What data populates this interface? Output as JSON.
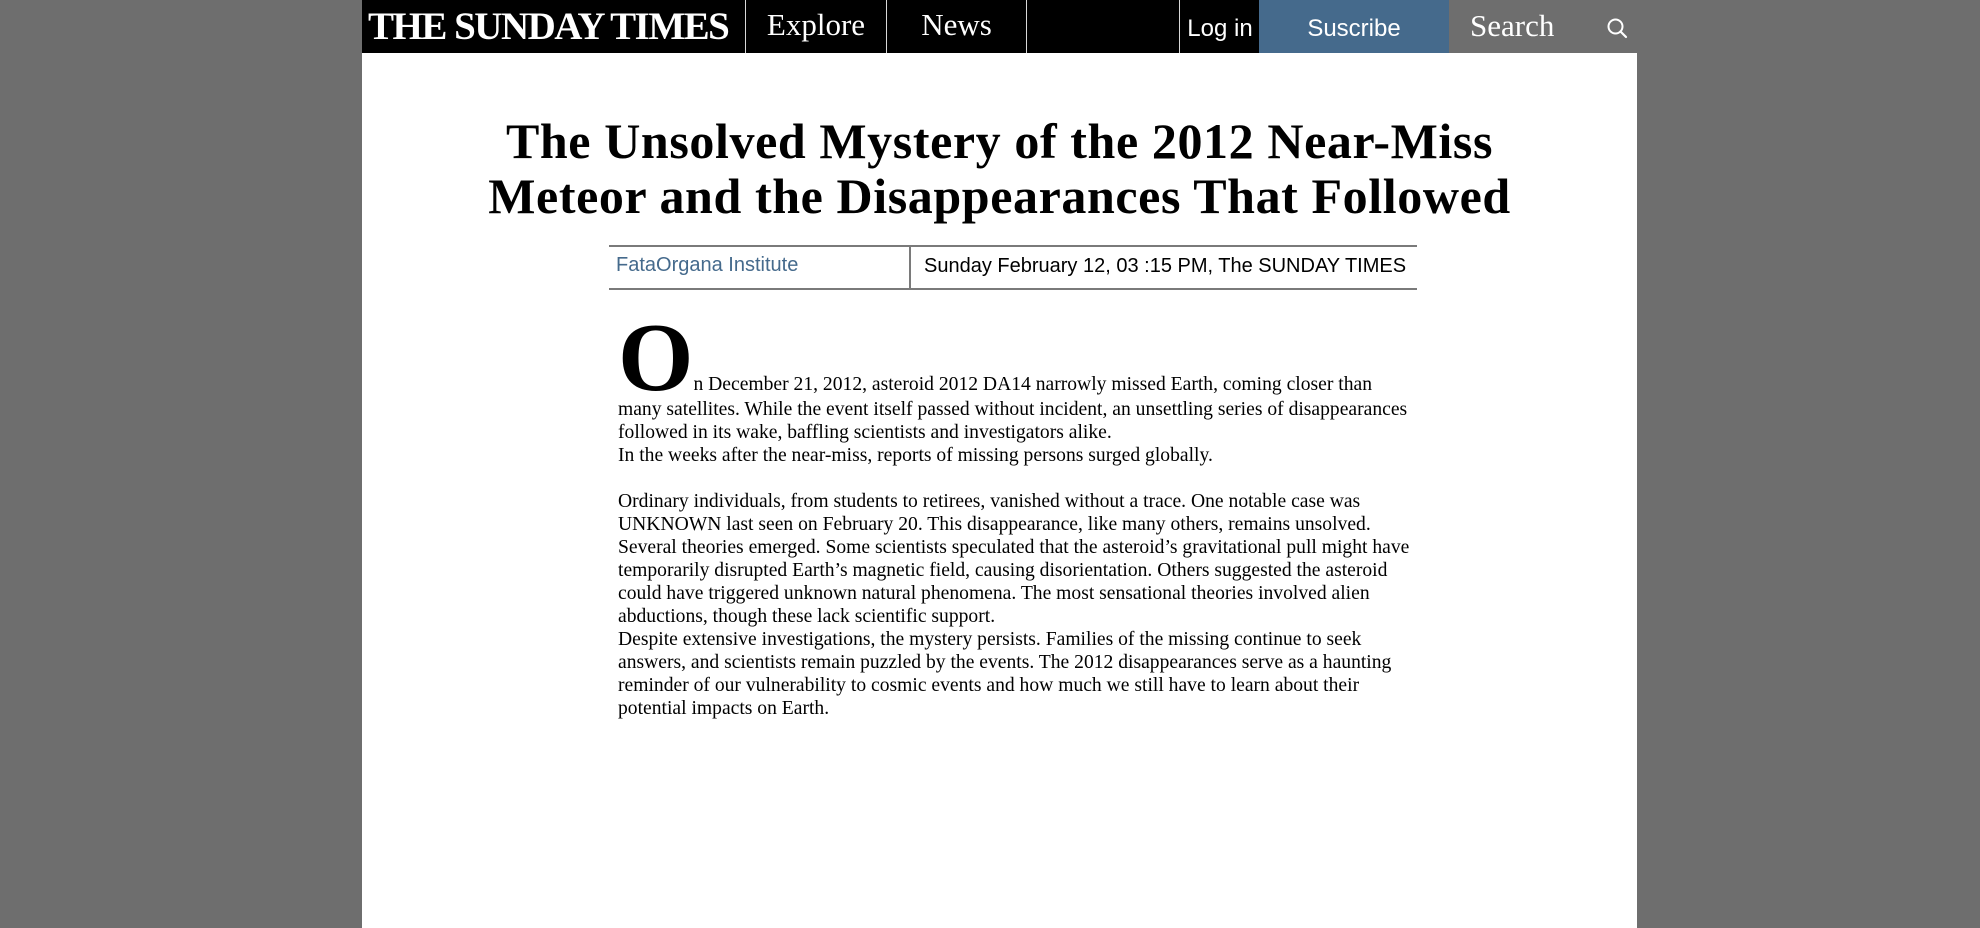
{
  "nav": {
    "masthead": "THE SUNDAY TIMES",
    "explore": "Explore",
    "news": "News",
    "login": "Log in",
    "subscribe": "Suscribe",
    "search": "Search"
  },
  "article": {
    "headline_line1": "The Unsolved Mystery of the 2012 Near-Miss",
    "headline_line2": "Meteor and the Disappearances That Followed",
    "author": "FataOrgana Institute",
    "dateline": "Sunday February 12, 03 :15 PM, The SUNDAY TIMES",
    "dropcap": "O",
    "p1_line1": "n December 21, 2012, asteroid 2012 DA14 narrowly missed Earth, coming closer than",
    "p1_rest": "many satellites. While the event itself passed without incident, an unsettling series of disappearances followed in its wake, baffling scientists and investigators alike.",
    "p2": "In the weeks after the near-miss, reports of missing persons surged globally.",
    "p3": "Ordinary individuals, from students to retirees, vanished without a trace. One notable case was UNKNOWN last seen on February 20. This disappearance, like many others, remains unsolved.",
    "p4": "Several theories emerged. Some scientists speculated that the asteroid’s gravitational pull might have temporarily disrupted Earth’s magnetic field, causing disorientation. Others suggested the asteroid could have triggered unknown natural phenomena. The most sensational theories involved alien abductions, though these lack scientific support.",
    "p5": "Despite extensive investigations, the mystery persists. Families of the missing continue to seek answers, and scientists remain puzzled by the events. The 2012 disappearances serve as a haunting reminder of our vulnerability to cosmic events and how much we still have to learn about their potential impacts on Earth."
  }
}
